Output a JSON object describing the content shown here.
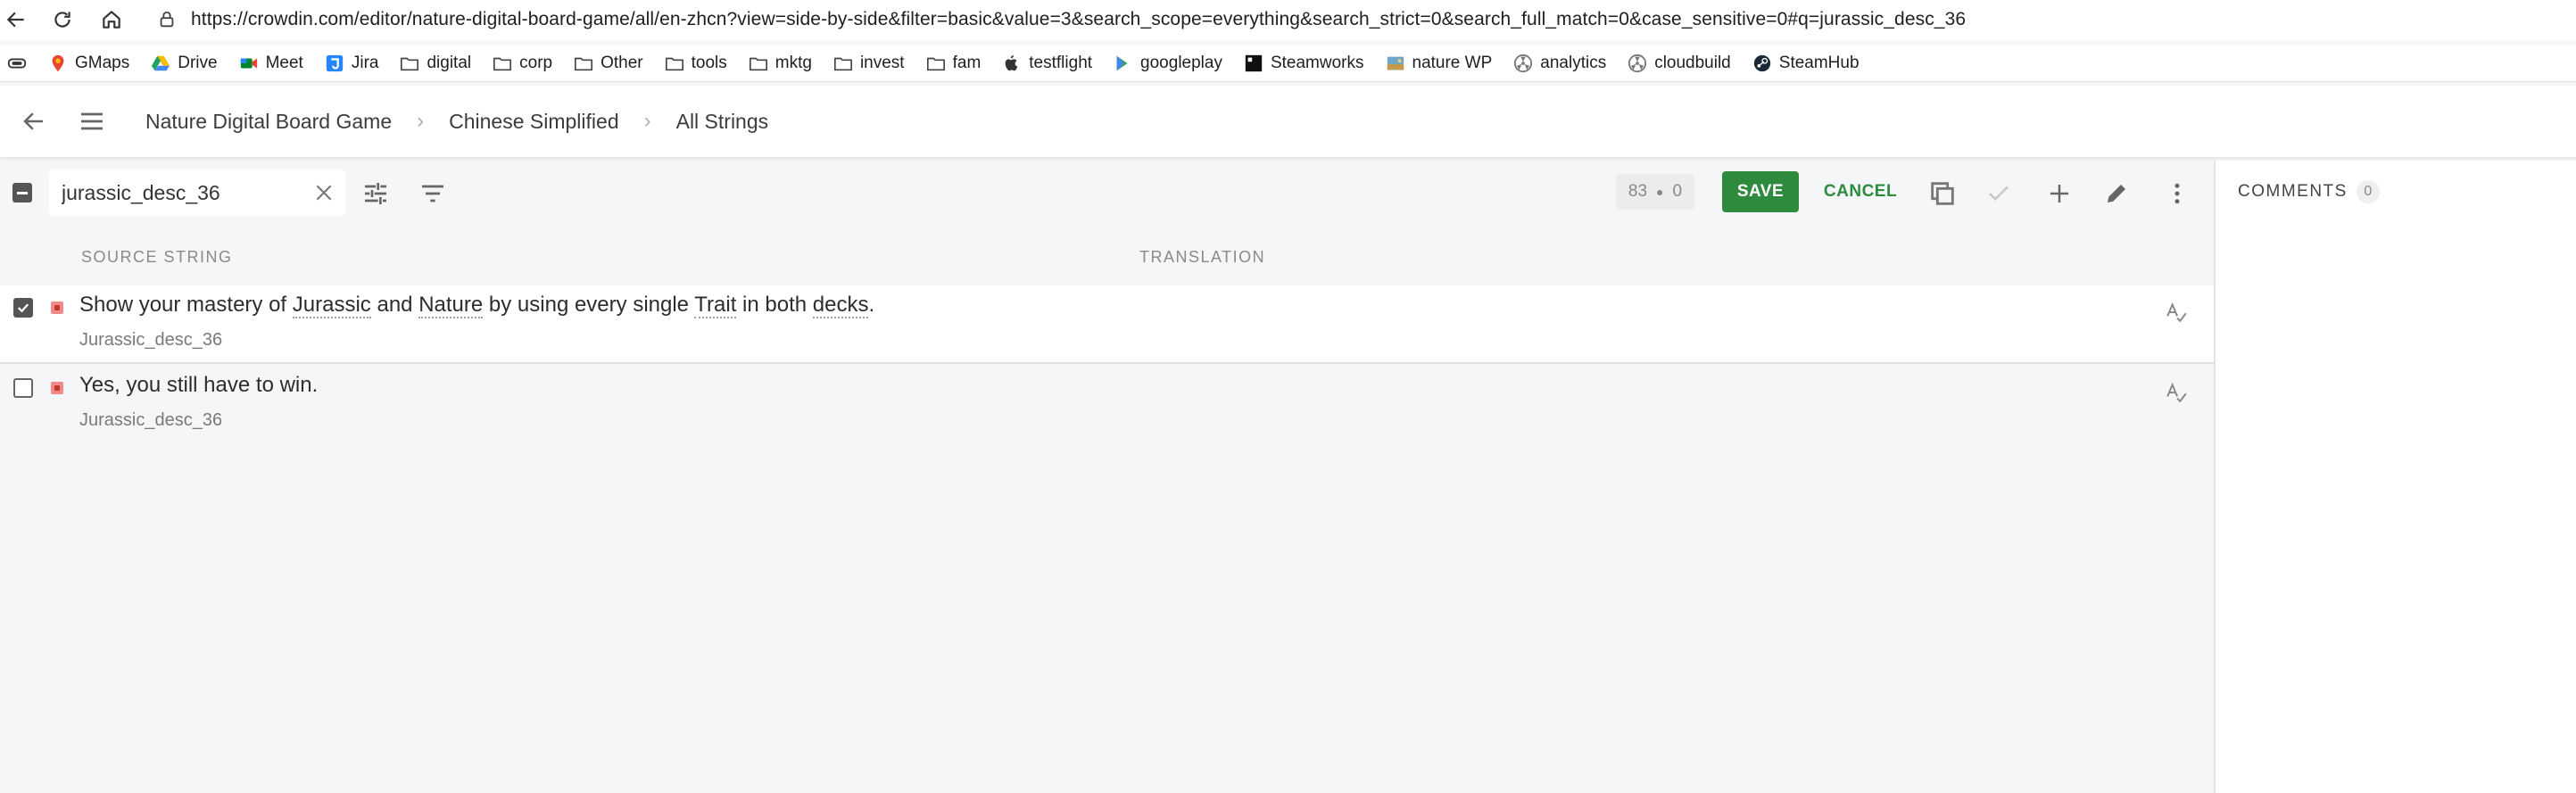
{
  "browser": {
    "url": "https://crowdin.com/editor/nature-digital-board-game/all/en-zhcn?view=side-by-side&filter=basic&value=3&search_scope=everything&search_strict=0&search_full_match=0&case_sensitive=0#q=jurassic_desc_36",
    "bookmarks": [
      {
        "label": "GMaps",
        "icon": "maps-pin-icon"
      },
      {
        "label": "Drive",
        "icon": "drive-icon"
      },
      {
        "label": "Meet",
        "icon": "meet-icon"
      },
      {
        "label": "Jira",
        "icon": "jira-icon"
      },
      {
        "label": "digital",
        "icon": "folder-icon"
      },
      {
        "label": "corp",
        "icon": "folder-icon"
      },
      {
        "label": "Other",
        "icon": "folder-icon"
      },
      {
        "label": "tools",
        "icon": "folder-icon"
      },
      {
        "label": "mktg",
        "icon": "folder-icon"
      },
      {
        "label": "invest",
        "icon": "folder-icon"
      },
      {
        "label": "fam",
        "icon": "folder-icon"
      },
      {
        "label": "testflight",
        "icon": "apple-icon"
      },
      {
        "label": "googleplay",
        "icon": "play-icon"
      },
      {
        "label": "Steamworks",
        "icon": "steamworks-icon"
      },
      {
        "label": "nature WP",
        "icon": "wp-icon"
      },
      {
        "label": "analytics",
        "icon": "radiation-icon"
      },
      {
        "label": "cloudbuild",
        "icon": "radiation-icon"
      },
      {
        "label": "SteamHub",
        "icon": "steam-icon"
      }
    ]
  },
  "header": {
    "breadcrumbs": [
      "Nature Digital Board Game",
      "Chinese Simplified",
      "All Strings"
    ]
  },
  "toolbar": {
    "search_value": "jurassic_desc_36",
    "counter_left": "83",
    "counter_right": "0",
    "save_label": "SAVE",
    "cancel_label": "CANCEL"
  },
  "columns": {
    "source": "SOURCE STRING",
    "translation": "TRANSLATION"
  },
  "rows": [
    {
      "checked": true,
      "source_parts": [
        "Show your mastery of ",
        "Jurassic",
        " and ",
        "Nature",
        " by using every single ",
        "Trait",
        " in both ",
        "decks",
        "."
      ],
      "key": "Jurassic_desc_36"
    },
    {
      "checked": false,
      "source_parts": [
        "Yes, you still have to win."
      ],
      "key": "Jurassic_desc_36"
    }
  ],
  "comments": {
    "title": "COMMENTS",
    "count": "0"
  },
  "colors": {
    "accent_green": "#2e8b3e",
    "status_red": "#f08a8a"
  }
}
